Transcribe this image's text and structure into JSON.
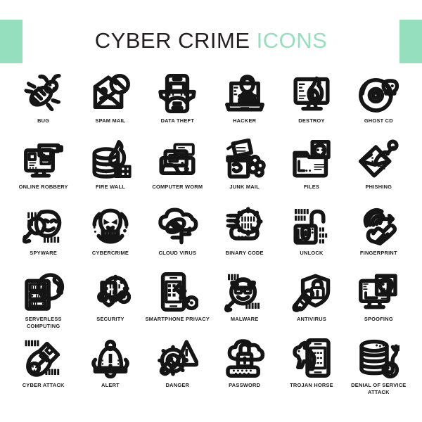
{
  "header": {
    "title_dark": "CYBER CRIME",
    "title_accent": "ICONS",
    "accent_color": "#96dfbe",
    "text_color": "#231f20"
  },
  "grid": {
    "columns": 6,
    "rows": 5,
    "icons": [
      {
        "icon": "bug-icon",
        "label": "BUG"
      },
      {
        "icon": "spam-mail-icon",
        "label": "SPAM MAIL"
      },
      {
        "icon": "data-theft-icon",
        "label": "DATA THEFT"
      },
      {
        "icon": "hacker-icon",
        "label": "HACKER"
      },
      {
        "icon": "destroy-icon",
        "label": "DESTROY"
      },
      {
        "icon": "ghost-cd-icon",
        "label": "GHOST CD"
      },
      {
        "icon": "online-robbery-icon",
        "label": "ONLINE ROBBERY"
      },
      {
        "icon": "fire-wall-icon",
        "label": "FIRE WALL"
      },
      {
        "icon": "computer-worm-icon",
        "label": "COMPUTER WORM"
      },
      {
        "icon": "junk-mail-icon",
        "label": "JUNK MAIL"
      },
      {
        "icon": "files-icon",
        "label": "FILES"
      },
      {
        "icon": "phishing-icon",
        "label": "PHISHING"
      },
      {
        "icon": "spyware-icon",
        "label": "SPYWARE"
      },
      {
        "icon": "cybercrime-icon",
        "label": "CYBERCRIME"
      },
      {
        "icon": "cloud-virus-icon",
        "label": "CLOUD VIRUS"
      },
      {
        "icon": "binary-code-icon",
        "label": "BINARY CODE"
      },
      {
        "icon": "unlock-icon",
        "label": "UNLOCK"
      },
      {
        "icon": "fingerprint-icon",
        "label": "FINGERPRINT"
      },
      {
        "icon": "serverless-computing-icon",
        "label": "SERVERLESS COMPUTING"
      },
      {
        "icon": "security-icon",
        "label": "SECURITY"
      },
      {
        "icon": "smartphone-privacy-icon",
        "label": "SMARTPHONE PRIVACY"
      },
      {
        "icon": "malware-icon",
        "label": "MALWARE"
      },
      {
        "icon": "antivirus-icon",
        "label": "ANTIVIRUS"
      },
      {
        "icon": "spoofing-icon",
        "label": "SPOOFING"
      },
      {
        "icon": "cyber-attack-icon",
        "label": "CYBER ATTACK"
      },
      {
        "icon": "alert-icon",
        "label": "ALERT"
      },
      {
        "icon": "danger-icon",
        "label": "DANGER"
      },
      {
        "icon": "password-icon",
        "label": "PASSWORD"
      },
      {
        "icon": "trojan-horse-icon",
        "label": "TROJAN HORSE"
      },
      {
        "icon": "denial-of-service-attack-icon",
        "label": "DENIAL OF SERVICE ATTACK"
      }
    ]
  }
}
